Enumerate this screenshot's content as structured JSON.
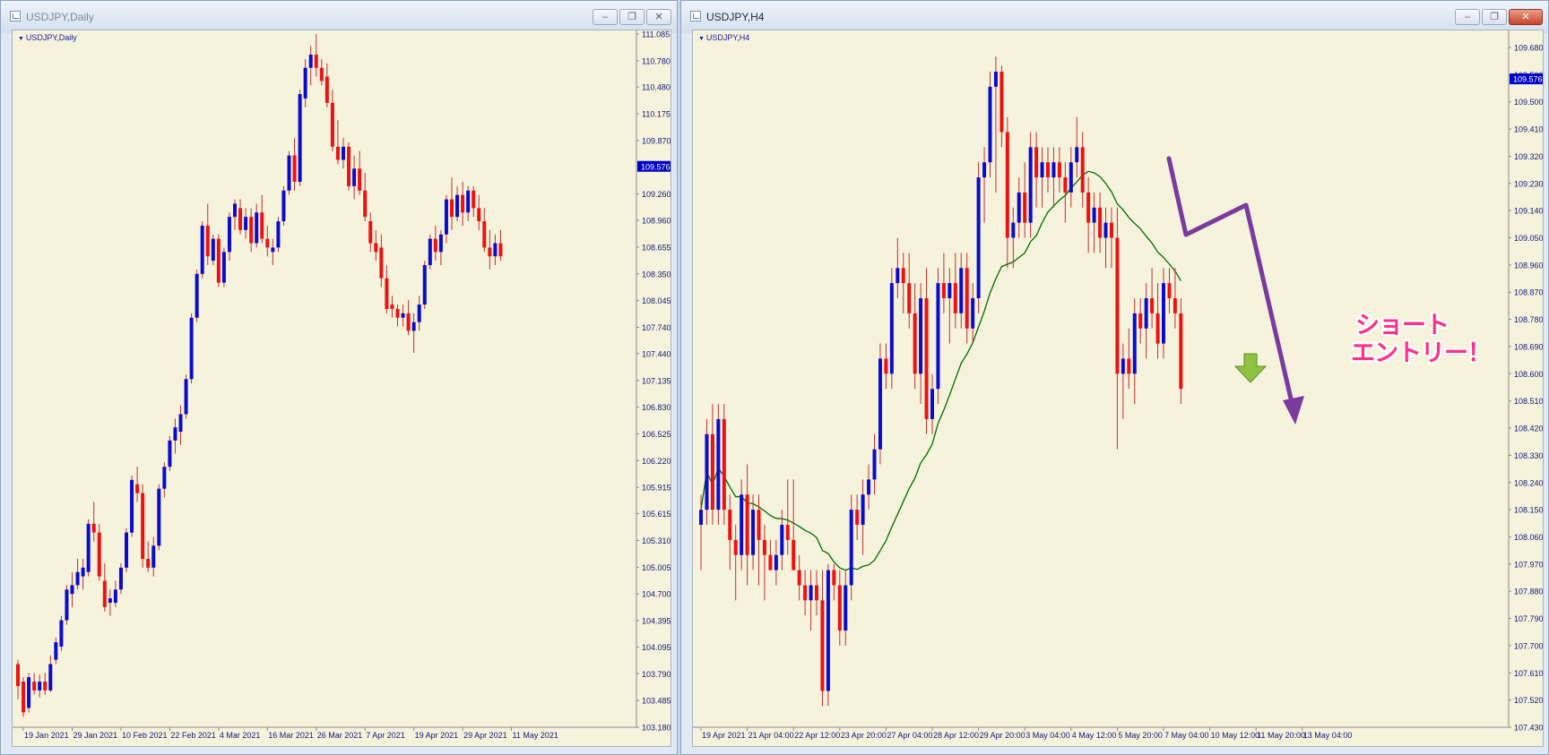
{
  "colors": {
    "bull": "#0b0bcc",
    "bear": "#ee1111",
    "wick": "#c03030",
    "ma": "#006b00",
    "axisText": "#15157a",
    "price": "#0000cc",
    "arrow": "#7a3a9e",
    "greenArrow": "#8fc243"
  },
  "left": {
    "title": "USDJPY,Daily",
    "symbol_label": "USDJPY,Daily",
    "current_price": "109.576",
    "buttons": [
      "minimize",
      "restore",
      "close"
    ]
  },
  "right": {
    "title": "USDJPY,H4",
    "symbol_label": "USDJPY,H4",
    "current_price": "109.576",
    "annotation": [
      "ショート",
      "エントリー！"
    ],
    "buttons": [
      "minimize",
      "restore",
      "close"
    ]
  },
  "chart_data": [
    {
      "type": "candlestick",
      "title": "USDJPY,Daily",
      "ylim": [
        103.18,
        111.085
      ],
      "yticks": [
        "111.085",
        "110.780",
        "110.480",
        "110.175",
        "109.870",
        "109.576",
        "109.260",
        "108.960",
        "108.655",
        "108.350",
        "108.045",
        "107.740",
        "107.440",
        "107.135",
        "106.830",
        "106.525",
        "106.220",
        "105.915",
        "105.615",
        "105.310",
        "105.005",
        "104.700",
        "104.395",
        "104.095",
        "103.790",
        "103.485",
        "103.180"
      ],
      "xticks": [
        {
          "label": "19 Jan 2021",
          "i": 1
        },
        {
          "label": "29 Jan 2021",
          "i": 10
        },
        {
          "label": "10 Feb 2021",
          "i": 19
        },
        {
          "label": "22 Feb 2021",
          "i": 28
        },
        {
          "label": "4 Mar 2021",
          "i": 37
        },
        {
          "label": "16 Mar 2021",
          "i": 46
        },
        {
          "label": "26 Mar 2021",
          "i": 55
        },
        {
          "label": "7 Apr 2021",
          "i": 64
        },
        {
          "label": "19 Apr 2021",
          "i": 73
        },
        {
          "label": "29 Apr 2021",
          "i": 82
        },
        {
          "label": "11 May 2021",
          "i": 91
        }
      ],
      "candles": [
        [
          103.9,
          103.95,
          103.5,
          103.65
        ],
        [
          103.7,
          103.75,
          103.3,
          103.35
        ],
        [
          103.4,
          103.8,
          103.35,
          103.75
        ],
        [
          103.7,
          103.8,
          103.55,
          103.6
        ],
        [
          103.6,
          103.78,
          103.52,
          103.7
        ],
        [
          103.7,
          103.8,
          103.55,
          103.6
        ],
        [
          103.6,
          104.0,
          103.58,
          103.9
        ],
        [
          103.95,
          104.2,
          103.9,
          104.15
        ],
        [
          104.1,
          104.45,
          104.05,
          104.4
        ],
        [
          104.4,
          104.8,
          104.35,
          104.75
        ],
        [
          104.7,
          104.95,
          104.55,
          104.8
        ],
        [
          104.8,
          105.1,
          104.75,
          104.95
        ],
        [
          104.9,
          105.1,
          104.75,
          105.0
        ],
        [
          104.95,
          105.55,
          104.9,
          105.5
        ],
        [
          105.5,
          105.75,
          105.3,
          105.4
        ],
        [
          105.4,
          105.5,
          104.85,
          104.9
        ],
        [
          104.85,
          105.05,
          104.5,
          104.55
        ],
        [
          104.6,
          104.75,
          104.45,
          104.65
        ],
        [
          104.6,
          104.85,
          104.55,
          104.75
        ],
        [
          104.75,
          105.05,
          104.7,
          105.0
        ],
        [
          105.0,
          105.45,
          104.95,
          105.4
        ],
        [
          105.4,
          106.05,
          105.35,
          106.0
        ],
        [
          105.95,
          106.15,
          105.75,
          105.85
        ],
        [
          105.85,
          105.95,
          105.0,
          105.1
        ],
        [
          105.1,
          105.3,
          104.95,
          105.0
        ],
        [
          105.0,
          105.35,
          104.9,
          105.25
        ],
        [
          105.25,
          105.95,
          105.2,
          105.9
        ],
        [
          105.9,
          106.2,
          105.8,
          106.15
        ],
        [
          106.15,
          106.5,
          106.1,
          106.45
        ],
        [
          106.45,
          106.7,
          106.3,
          106.6
        ],
        [
          106.55,
          106.85,
          106.4,
          106.75
        ],
        [
          106.75,
          107.2,
          106.7,
          107.15
        ],
        [
          107.15,
          107.9,
          107.1,
          107.85
        ],
        [
          107.85,
          108.4,
          107.8,
          108.35
        ],
        [
          108.35,
          108.95,
          108.3,
          108.9
        ],
        [
          108.9,
          109.15,
          108.45,
          108.55
        ],
        [
          108.5,
          108.8,
          108.45,
          108.75
        ],
        [
          108.75,
          108.8,
          108.2,
          108.25
        ],
        [
          108.25,
          108.65,
          108.2,
          108.6
        ],
        [
          108.6,
          109.05,
          108.5,
          109.0
        ],
        [
          109.0,
          109.2,
          108.85,
          109.15
        ],
        [
          109.1,
          109.2,
          108.8,
          108.85
        ],
        [
          108.85,
          109.1,
          108.75,
          109.0
        ],
        [
          109.0,
          109.1,
          108.6,
          108.7
        ],
        [
          108.7,
          109.15,
          108.65,
          109.05
        ],
        [
          109.05,
          109.25,
          108.7,
          108.75
        ],
        [
          108.75,
          108.9,
          108.55,
          108.65
        ],
        [
          108.6,
          108.75,
          108.45,
          108.65
        ],
        [
          108.65,
          109.0,
          108.6,
          108.95
        ],
        [
          108.95,
          109.35,
          108.9,
          109.3
        ],
        [
          109.3,
          109.75,
          109.25,
          109.7
        ],
        [
          109.7,
          109.9,
          109.3,
          109.4
        ],
        [
          109.4,
          110.45,
          109.35,
          110.4
        ],
        [
          110.35,
          110.8,
          110.25,
          110.7
        ],
        [
          110.7,
          110.95,
          110.5,
          110.85
        ],
        [
          110.85,
          111.085,
          110.6,
          110.7
        ],
        [
          110.7,
          110.8,
          110.5,
          110.55
        ],
        [
          110.6,
          110.75,
          110.25,
          110.3
        ],
        [
          110.3,
          110.45,
          109.75,
          109.8
        ],
        [
          109.8,
          110.1,
          109.6,
          109.65
        ],
        [
          109.65,
          109.9,
          109.55,
          109.8
        ],
        [
          109.8,
          109.85,
          109.3,
          109.35
        ],
        [
          109.35,
          109.7,
          109.2,
          109.55
        ],
        [
          109.55,
          109.75,
          109.25,
          109.3
        ],
        [
          109.3,
          109.5,
          108.95,
          109.0
        ],
        [
          108.95,
          109.05,
          108.6,
          108.7
        ],
        [
          108.7,
          108.85,
          108.5,
          108.6
        ],
        [
          108.65,
          108.8,
          108.2,
          108.3
        ],
        [
          108.3,
          108.45,
          107.9,
          107.95
        ],
        [
          108.0,
          108.1,
          107.85,
          107.95
        ],
        [
          107.95,
          108.0,
          107.75,
          107.85
        ],
        [
          107.85,
          108.0,
          107.75,
          107.9
        ],
        [
          107.9,
          108.05,
          107.65,
          107.7
        ],
        [
          107.7,
          107.9,
          107.45,
          107.8
        ],
        [
          107.8,
          108.1,
          107.7,
          108.0
        ],
        [
          108.0,
          108.5,
          107.95,
          108.45
        ],
        [
          108.45,
          108.8,
          108.4,
          108.75
        ],
        [
          108.75,
          108.9,
          108.5,
          108.6
        ],
        [
          108.6,
          108.85,
          108.45,
          108.8
        ],
        [
          108.8,
          109.25,
          108.7,
          109.2
        ],
        [
          109.2,
          109.45,
          108.85,
          109.0
        ],
        [
          109.0,
          109.35,
          108.95,
          109.25
        ],
        [
          109.25,
          109.4,
          108.9,
          109.05
        ],
        [
          109.05,
          109.35,
          108.95,
          109.3
        ],
        [
          109.3,
          109.35,
          109.0,
          109.1
        ],
        [
          109.1,
          109.25,
          108.85,
          108.95
        ],
        [
          108.95,
          109.1,
          108.6,
          108.65
        ],
        [
          108.65,
          108.85,
          108.4,
          108.55
        ],
        [
          108.55,
          108.8,
          108.45,
          108.7
        ],
        [
          108.7,
          108.85,
          108.5,
          108.55
        ]
      ]
    },
    {
      "type": "candlestick",
      "title": "USDJPY,H4",
      "ylim": [
        107.43,
        109.68
      ],
      "yticks": [
        "109.680",
        "109.590",
        "109.576",
        "109.500",
        "109.410",
        "109.320",
        "109.230",
        "109.140",
        "109.050",
        "108.960",
        "108.870",
        "108.780",
        "108.690",
        "108.600",
        "108.510",
        "108.420",
        "108.330",
        "108.240",
        "108.150",
        "108.060",
        "107.970",
        "107.880",
        "107.790",
        "107.700",
        "107.610",
        "107.520",
        "107.430"
      ],
      "xticks": [
        {
          "label": "19 Apr 2021",
          "i": 0
        },
        {
          "label": "21 Apr 04:00",
          "i": 8
        },
        {
          "label": "22 Apr 12:00",
          "i": 16
        },
        {
          "label": "23 Apr 20:00",
          "i": 24
        },
        {
          "label": "27 Apr 04:00",
          "i": 32
        },
        {
          "label": "28 Apr 12:00",
          "i": 40
        },
        {
          "label": "29 Apr 20:00",
          "i": 48
        },
        {
          "label": "3 May 04:00",
          "i": 56
        },
        {
          "label": "4 May 12:00",
          "i": 64
        },
        {
          "label": "5 May 20:00",
          "i": 72
        },
        {
          "label": "7 May 04:00",
          "i": 80
        },
        {
          "label": "10 May 12:00",
          "i": 88
        },
        {
          "label": "11 May 20:00",
          "i": 96
        },
        {
          "label": "13 May 04:00",
          "i": 104
        }
      ],
      "ma_period": 20,
      "annotation": [
        "ショート",
        "エントリー！"
      ],
      "candles": [
        [
          108.1,
          108.2,
          107.95,
          108.15
        ],
        [
          108.15,
          108.45,
          108.1,
          108.4
        ],
        [
          108.4,
          108.5,
          108.1,
          108.15
        ],
        [
          108.15,
          108.5,
          108.1,
          108.45
        ],
        [
          108.45,
          108.5,
          108.1,
          108.15
        ],
        [
          108.15,
          108.2,
          107.95,
          108.05
        ],
        [
          108.05,
          108.1,
          107.85,
          108.0
        ],
        [
          108.0,
          108.25,
          107.95,
          108.2
        ],
        [
          108.2,
          108.3,
          107.9,
          108.0
        ],
        [
          108.0,
          108.2,
          107.95,
          108.15
        ],
        [
          108.15,
          108.2,
          107.9,
          108.05
        ],
        [
          108.05,
          108.1,
          107.85,
          108.0
        ],
        [
          108.0,
          108.05,
          107.95,
          107.95
        ],
        [
          107.95,
          108.05,
          107.9,
          108.0
        ],
        [
          108.0,
          108.15,
          107.95,
          108.1
        ],
        [
          108.1,
          108.25,
          108.0,
          108.05
        ],
        [
          108.05,
          108.25,
          107.95,
          107.95
        ],
        [
          107.95,
          108.0,
          107.85,
          107.9
        ],
        [
          107.9,
          107.95,
          107.8,
          107.85
        ],
        [
          107.85,
          107.95,
          107.75,
          107.9
        ],
        [
          107.9,
          107.95,
          107.8,
          107.85
        ],
        [
          107.85,
          107.95,
          107.5,
          107.55
        ],
        [
          107.55,
          107.97,
          107.5,
          107.95
        ],
        [
          107.95,
          107.97,
          107.85,
          107.9
        ],
        [
          107.9,
          107.95,
          107.7,
          107.75
        ],
        [
          107.75,
          107.95,
          107.7,
          107.9
        ],
        [
          107.9,
          108.2,
          107.85,
          108.15
        ],
        [
          108.15,
          108.2,
          108.05,
          108.1
        ],
        [
          108.1,
          108.25,
          108.0,
          108.2
        ],
        [
          108.2,
          108.3,
          108.15,
          108.25
        ],
        [
          108.25,
          108.4,
          108.2,
          108.35
        ],
        [
          108.35,
          108.7,
          108.3,
          108.65
        ],
        [
          108.65,
          108.7,
          108.55,
          108.6
        ],
        [
          108.6,
          108.95,
          108.55,
          108.9
        ],
        [
          108.9,
          109.05,
          108.85,
          108.95
        ],
        [
          108.95,
          109.0,
          108.8,
          108.9
        ],
        [
          108.9,
          109.0,
          108.75,
          108.8
        ],
        [
          108.8,
          108.9,
          108.55,
          108.6
        ],
        [
          108.6,
          108.9,
          108.5,
          108.85
        ],
        [
          108.85,
          108.95,
          108.4,
          108.45
        ],
        [
          108.45,
          108.6,
          108.4,
          108.55
        ],
        [
          108.55,
          108.95,
          108.5,
          108.9
        ],
        [
          108.9,
          109.0,
          108.8,
          108.85
        ],
        [
          108.85,
          108.95,
          108.7,
          108.9
        ],
        [
          108.9,
          109.0,
          108.75,
          108.8
        ],
        [
          108.8,
          109.0,
          108.75,
          108.95
        ],
        [
          108.95,
          109.0,
          108.7,
          108.75
        ],
        [
          108.75,
          108.9,
          108.7,
          108.85
        ],
        [
          108.85,
          109.3,
          108.8,
          109.25
        ],
        [
          109.25,
          109.35,
          109.1,
          109.3
        ],
        [
          109.3,
          109.6,
          109.25,
          109.55
        ],
        [
          109.55,
          109.65,
          109.2,
          109.6
        ],
        [
          109.6,
          109.62,
          109.35,
          109.4
        ],
        [
          109.4,
          109.45,
          108.95,
          109.05
        ],
        [
          109.05,
          109.15,
          108.95,
          109.1
        ],
        [
          109.1,
          109.25,
          109.05,
          109.2
        ],
        [
          109.2,
          109.3,
          109.05,
          109.1
        ],
        [
          109.1,
          109.4,
          109.05,
          109.35
        ],
        [
          109.35,
          109.4,
          109.15,
          109.25
        ],
        [
          109.25,
          109.35,
          109.15,
          109.3
        ],
        [
          109.3,
          109.35,
          109.2,
          109.25
        ],
        [
          109.25,
          109.35,
          109.15,
          109.3
        ],
        [
          109.3,
          109.35,
          109.2,
          109.25
        ],
        [
          109.25,
          109.3,
          109.1,
          109.2
        ],
        [
          109.2,
          109.35,
          109.15,
          109.3
        ],
        [
          109.3,
          109.45,
          109.25,
          109.35
        ],
        [
          109.35,
          109.4,
          109.15,
          109.2
        ],
        [
          109.2,
          109.25,
          109.0,
          109.1
        ],
        [
          109.1,
          109.2,
          109.0,
          109.15
        ],
        [
          109.15,
          109.2,
          109.0,
          109.05
        ],
        [
          109.05,
          109.15,
          108.95,
          109.1
        ],
        [
          109.1,
          109.15,
          108.95,
          109.05
        ],
        [
          109.05,
          109.15,
          108.35,
          108.6
        ],
        [
          108.6,
          108.7,
          108.45,
          108.65
        ],
        [
          108.65,
          108.75,
          108.55,
          108.6
        ],
        [
          108.6,
          108.85,
          108.5,
          108.8
        ],
        [
          108.8,
          108.85,
          108.7,
          108.75
        ],
        [
          108.75,
          108.9,
          108.65,
          108.85
        ],
        [
          108.85,
          108.95,
          108.75,
          108.8
        ],
        [
          108.8,
          108.9,
          108.65,
          108.7
        ],
        [
          108.7,
          108.95,
          108.65,
          108.9
        ],
        [
          108.9,
          108.95,
          108.8,
          108.85
        ],
        [
          108.85,
          108.95,
          108.75,
          108.8
        ],
        [
          108.8,
          108.85,
          108.5,
          108.55
        ]
      ]
    }
  ]
}
